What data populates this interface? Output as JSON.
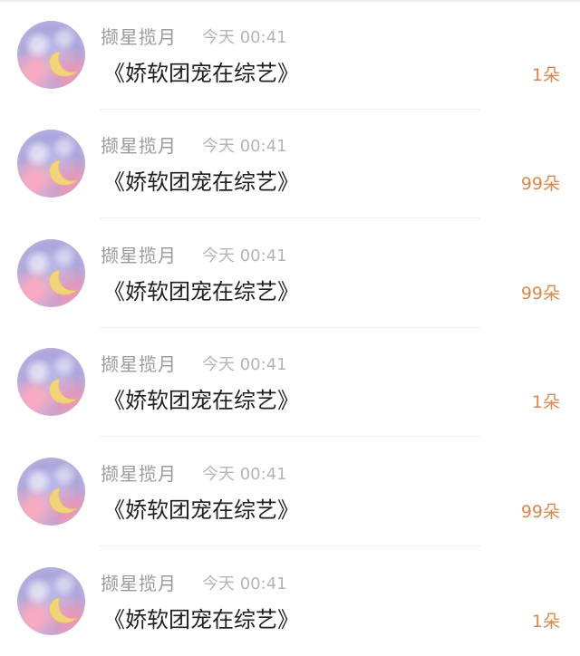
{
  "gift_list": {
    "items": [
      {
        "username": "撷星揽月",
        "time": "今天 00:41",
        "title": "《娇软团宠在综艺》",
        "count": "1朵"
      },
      {
        "username": "撷星揽月",
        "time": "今天 00:41",
        "title": "《娇软团宠在综艺》",
        "count": "99朵"
      },
      {
        "username": "撷星揽月",
        "time": "今天 00:41",
        "title": "《娇软团宠在综艺》",
        "count": "99朵"
      },
      {
        "username": "撷星揽月",
        "time": "今天 00:41",
        "title": "《娇软团宠在综艺》",
        "count": "1朵"
      },
      {
        "username": "撷星揽月",
        "time": "今天 00:41",
        "title": "《娇软团宠在综艺》",
        "count": "99朵"
      },
      {
        "username": "撷星揽月",
        "time": "今天 00:41",
        "title": "《娇软团宠在综艺》",
        "count": "1朵"
      }
    ]
  },
  "colors": {
    "username": "#9a9a9a",
    "time": "#b5b5b5",
    "title": "#1f1f1f",
    "count_accent": "#d9884f",
    "moon": "#f3d37a"
  },
  "icons": {
    "avatar": "moon-avatar-icon"
  }
}
